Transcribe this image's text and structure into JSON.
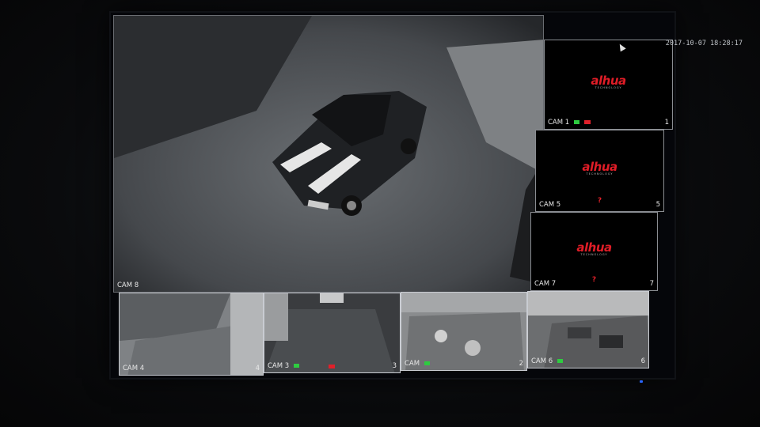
{
  "timestamp": "2017-10-07 18:28:17",
  "brand": "alhua",
  "brand_sub": "TECHNOLOGY",
  "tiles": {
    "cam8": {
      "label": "CAM 8",
      "num": "8"
    },
    "cam1": {
      "label": "CAM 1",
      "num": "1"
    },
    "cam5": {
      "label": "CAM 5",
      "num": "5"
    },
    "cam7": {
      "label": "CAM 7",
      "num": "7"
    },
    "cam4": {
      "label": "CAM 4",
      "num": "4"
    },
    "cam3": {
      "label": "CAM 3",
      "num": "3"
    },
    "cam2": {
      "label": "CAM",
      "num": "2"
    },
    "cam6": {
      "label": "CAM 6",
      "num": "6"
    }
  },
  "no_signal_icon": "?",
  "colors": {
    "brand_red": "#e01d27",
    "record_green": "#2ecc40",
    "alarm_red": "#e0202a"
  }
}
